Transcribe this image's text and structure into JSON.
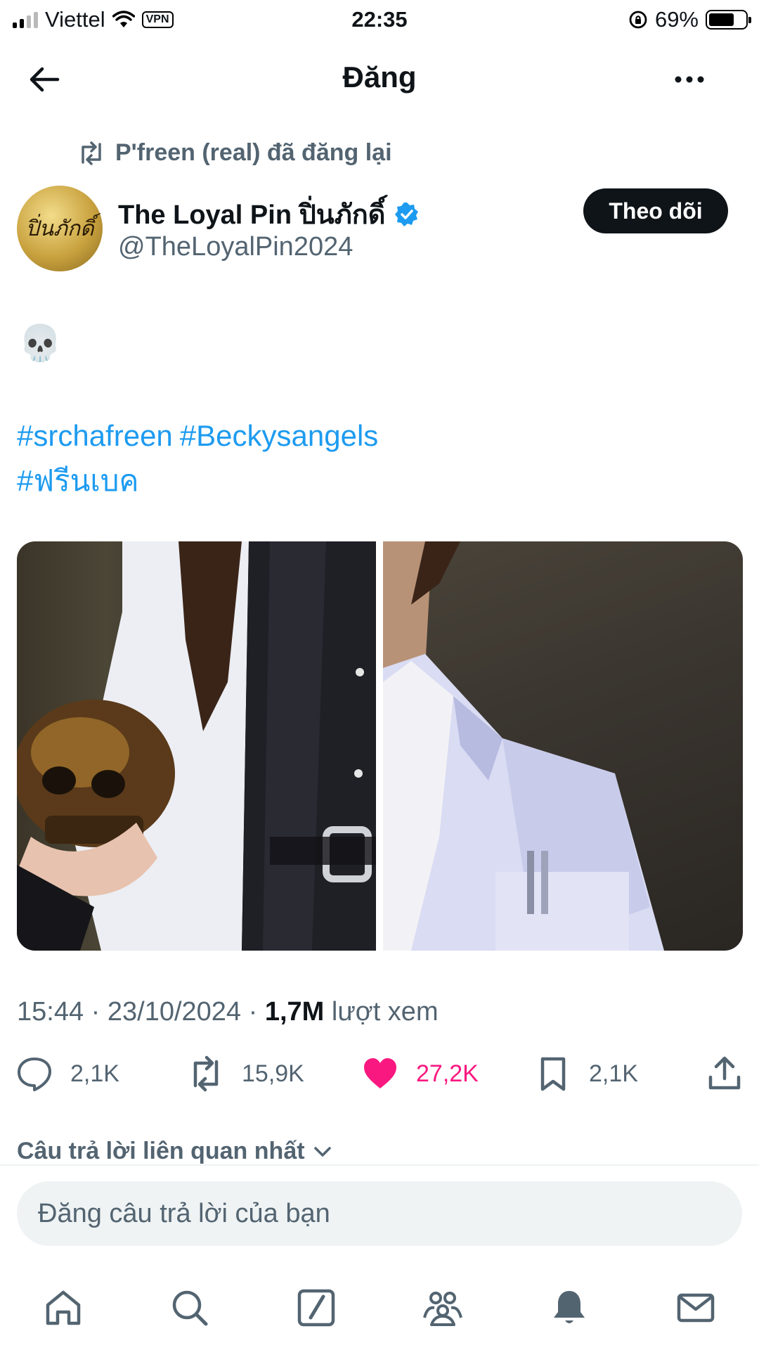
{
  "status_bar": {
    "carrier": "Viettel",
    "vpn": "VPN",
    "time": "22:35",
    "battery_percent": "69%",
    "battery_level": 0.69,
    "icons": [
      "signal-icon",
      "wifi-icon",
      "rotation-lock-icon",
      "battery-icon"
    ]
  },
  "header": {
    "title": "Đăng",
    "back_icon": "back-arrow-icon",
    "more_icon": "more-icon"
  },
  "repost": {
    "text": "P'freen (real) đã đăng lại",
    "icon": "repost-icon"
  },
  "author": {
    "name": "The Loyal Pin ปิ่นภักดิ์",
    "handle": "@TheLoyalPin2024",
    "avatar_text": "ปิ่นภักดิ์",
    "verified": true,
    "follow_label": "Theo dõi"
  },
  "tweet": {
    "emoji": "💀",
    "hashtags": [
      "#srchafreen",
      "#Beckysangels",
      "#ฟรีนเบค"
    ],
    "media_count": 2
  },
  "meta": {
    "time": "15:44",
    "date": "23/10/2024",
    "views": "1,7M",
    "views_label": "lượt xem",
    "separator": "·"
  },
  "actions": {
    "replies": "2,1K",
    "reposts": "15,9K",
    "likes": "27,2K",
    "bookmarks": "2,1K",
    "icons": [
      "reply-icon",
      "repost-icon",
      "like-icon",
      "bookmark-icon",
      "share-icon"
    ],
    "liked_color": "#f91880"
  },
  "replies": {
    "heading": "Câu trả lời liên quan nhất",
    "placeholder": "Đăng câu trả lời của bạn"
  },
  "bottom_nav": {
    "items": [
      "home-icon",
      "search-icon",
      "grok-icon",
      "communities-icon",
      "notifications-icon",
      "messages-icon"
    ]
  },
  "colors": {
    "accent": "#1d9bf0",
    "secondary_text": "#536471",
    "like": "#f91880",
    "follow_button": "#0f1419"
  }
}
